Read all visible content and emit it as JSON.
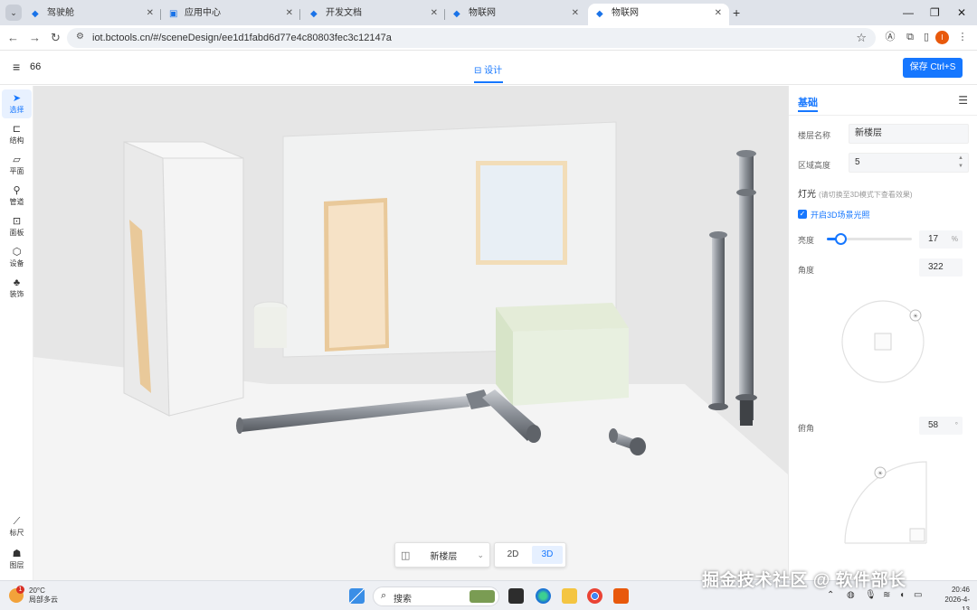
{
  "browser": {
    "tabs": [
      {
        "label": "驾驶舱",
        "active": false
      },
      {
        "label": "应用中心",
        "active": false
      },
      {
        "label": "开发文档",
        "active": false
      },
      {
        "label": "物联网",
        "active": false
      },
      {
        "label": "物联网",
        "active": true
      }
    ],
    "url": "iot.bctools.cn/#/sceneDesign/ee1d1fabd6d77e4c80803fec3c12147a",
    "profile_letter": "I"
  },
  "app": {
    "project_name": "66",
    "center_tab": "设计",
    "save_label": "保存 Ctrl+S"
  },
  "left_toolbar": {
    "tools": [
      {
        "label": "选择",
        "icon": "cursor-icon"
      },
      {
        "label": "结构",
        "icon": "structure-icon"
      },
      {
        "label": "平面",
        "icon": "plane-icon"
      },
      {
        "label": "管道",
        "icon": "pipe-icon"
      },
      {
        "label": "面板",
        "icon": "panel-icon"
      },
      {
        "label": "设备",
        "icon": "device-icon"
      },
      {
        "label": "装饰",
        "icon": "decoration-icon"
      }
    ],
    "bottom_tools": [
      {
        "label": "标尺",
        "icon": "ruler-icon"
      },
      {
        "label": "图层",
        "icon": "layers-icon"
      }
    ]
  },
  "viewport": {
    "floor_name": "新楼层",
    "modes": [
      "2D",
      "3D"
    ],
    "active_mode": "3D"
  },
  "right_panel": {
    "tab": "基础",
    "floor_name_label": "楼层名称",
    "floor_name_value": "新楼层",
    "area_height_label": "区域高度",
    "area_height_value": "5",
    "light_section": "灯光",
    "light_hint": "(请切换至3D模式下查看效果)",
    "enable_light_label": "开启3D场景光照",
    "brightness_label": "亮度",
    "brightness_value": "17",
    "brightness_unit": "%",
    "brightness_fraction": 0.17,
    "angle_label": "角度",
    "angle_value": "322",
    "pitch_label": "俯角",
    "pitch_value": "58",
    "pitch_unit": "°"
  },
  "taskbar": {
    "temperature": "20°C",
    "weather": "局部多云",
    "search_label": "搜索",
    "time": "20:46",
    "date": "2026-4-13"
  },
  "watermark": "掘金技术社区 @ 软件部长"
}
